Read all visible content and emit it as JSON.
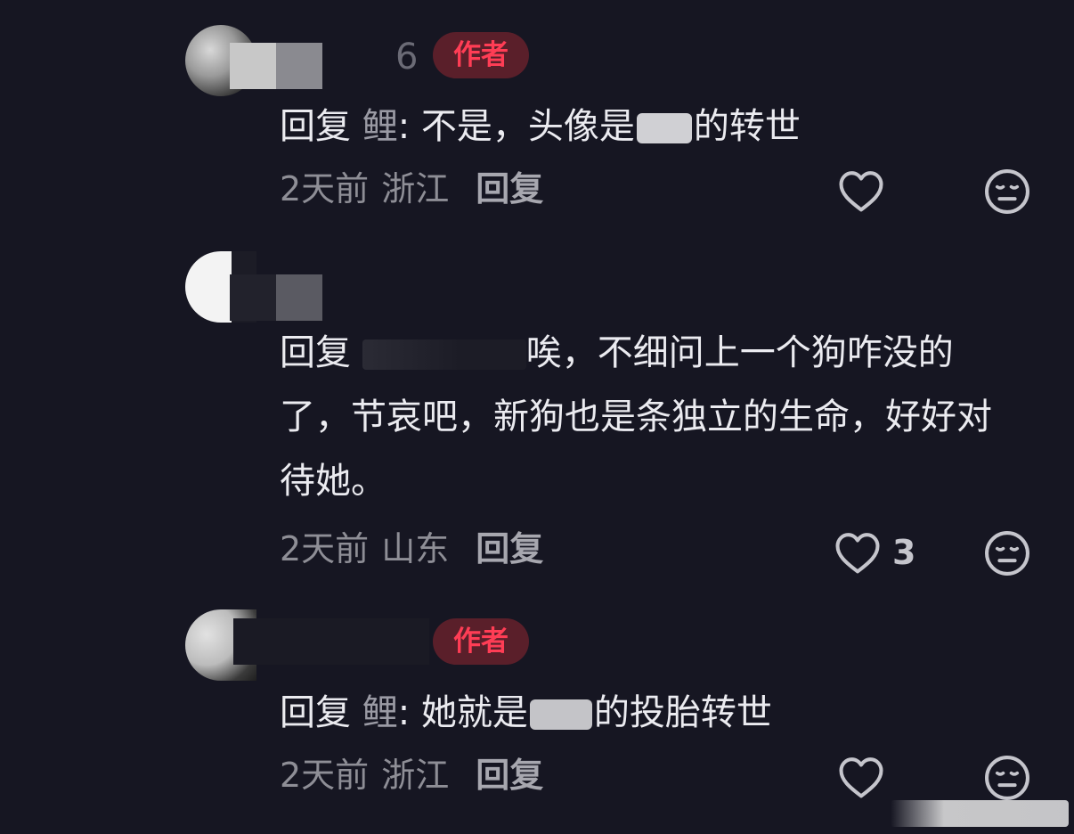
{
  "comments": [
    {
      "name_fragment": "6",
      "badge": "作者",
      "reply_prefix": "回复",
      "reply_target": "鲤",
      "text_before": ": 不是，头像是",
      "text_after": "的转世",
      "time": "2天前",
      "location": "浙江",
      "reply_label": "回复",
      "like_count": ""
    },
    {
      "reply_prefix": "回复",
      "text_after": "唉，不细问上一个狗咋没的了，节哀吧，新狗也是条独立的生命，好好对待她。",
      "time": "2天前",
      "location": "山东",
      "reply_label": "回复",
      "like_count": "3"
    },
    {
      "badge": "作者",
      "reply_prefix": "回复",
      "reply_target": "鲤",
      "text_before": ": 她就是",
      "text_after": "的投胎转世",
      "time": "2天前",
      "location": "浙江",
      "reply_label": "回复",
      "like_count": ""
    }
  ],
  "icons": {
    "like": "heart-outline-icon",
    "dislike": "unamused-face-icon"
  },
  "colors": {
    "background": "#161622",
    "badge_text": "#ff3d55",
    "badge_bg": "#5a1f2a",
    "meta_text": "#8e8e96"
  }
}
